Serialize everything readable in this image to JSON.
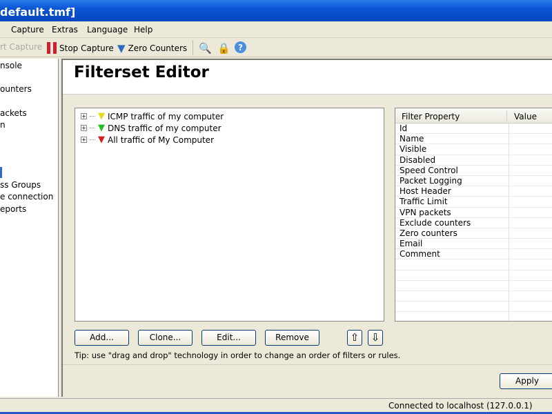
{
  "window": {
    "title": "default.tmf]"
  },
  "menu": [
    "Capture",
    "Extras",
    "Language",
    "Help"
  ],
  "toolbar": {
    "start_capture": "rt Capture",
    "stop_capture": "Stop Capture",
    "zero_counters": "Zero Counters"
  },
  "sidebar": {
    "items": [
      "nsole",
      "ounters",
      "ackets",
      "n",
      "ss Groups",
      "e connection",
      "eports"
    ]
  },
  "header": {
    "title": "Filterset Editor"
  },
  "tree": {
    "nodes": [
      {
        "label": "ICMP traffic of my computer",
        "color": "#f0e020"
      },
      {
        "label": "DNS traffic of my computer",
        "color": "#20c020"
      },
      {
        "label": "All traffic of My Computer",
        "color": "#d02020"
      }
    ]
  },
  "grid": {
    "col_property": "Filter Property",
    "col_value": "Value",
    "rows": [
      "Id",
      "Name",
      "Visible",
      "Disabled",
      "Speed Control",
      "Packet Logging",
      "Host Header",
      "Traffic Limit",
      "VPN packets",
      "Exclude counters",
      "Zero counters",
      "Email",
      "Comment"
    ]
  },
  "buttons": {
    "add": "Add...",
    "clone": "Clone...",
    "edit": "Edit...",
    "remove": "Remove",
    "apply": "Apply",
    "up": "⇧",
    "down": "⇩"
  },
  "tip": "Tip: use \"drag and drop\" technology in order to change an order of filters or rules.",
  "status": "Connected to localhost (127.0.0.1)"
}
